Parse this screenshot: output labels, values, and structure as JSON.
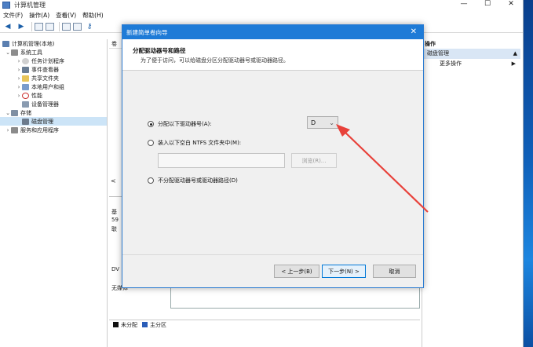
{
  "window": {
    "title": "计算机管理",
    "controls": {
      "minimize": "—",
      "maximize": "☐",
      "close": "✕"
    }
  },
  "menu": [
    "文件(F)",
    "操作(A)",
    "查看(V)",
    "帮助(H)"
  ],
  "tree": {
    "root": "计算机管理(本地)",
    "system_tools": "系统工具",
    "task_scheduler": "任务计划程序",
    "event_viewer": "事件查看器",
    "shared_folders": "共享文件夹",
    "local_users": "本地用户和组",
    "performance": "性能",
    "device_manager": "设备管理器",
    "storage": "存储",
    "disk_management": "磁盘管理",
    "services_apps": "服务和应用程序"
  },
  "middle": {
    "header": "卷",
    "disk_prefix_1": "基",
    "disk_size": "59",
    "disk_status": "联",
    "dvd_label": "DV",
    "no_media": "无媒体",
    "left_arrow": "<"
  },
  "legend": {
    "unallocated": "未分配",
    "primary": "主分区"
  },
  "actions": {
    "header": "操作",
    "group": "磁盘管理",
    "more": "更多操作"
  },
  "dialog": {
    "title": "新建简单卷向导",
    "heading": "分配驱动器号和路径",
    "subheading": "为了便于访问，可以给磁盘分区分配驱动器号或驱动器路径。",
    "option_assign": "分配以下驱动器号(A):",
    "drive_letter": "D",
    "option_mount": "装入以下空白 NTFS 文件夹中(M):",
    "browse": "浏览(R)...",
    "option_none": "不分配驱动器号或驱动器路径(D)",
    "back": "< 上一步(B)",
    "next": "下一步(N) >",
    "cancel": "取消",
    "close": "✕"
  },
  "colors": {
    "dialog_title_bg": "#1e7bd7",
    "arrow": "#e8413a",
    "unallocated": "#111111",
    "primary": "#2a5db8"
  }
}
